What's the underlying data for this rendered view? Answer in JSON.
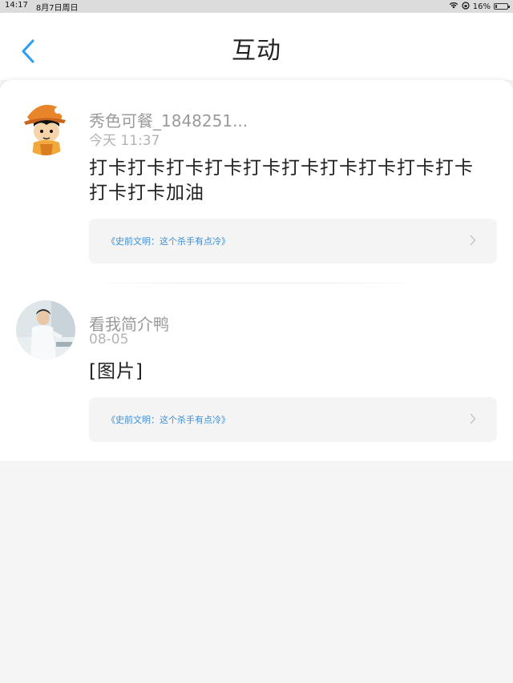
{
  "status_bar": {
    "time": "14:17",
    "date": "8月7日周日",
    "battery": "16%",
    "battery_level": 0.16
  },
  "header": {
    "title": "互动"
  },
  "items": [
    {
      "name": "秀色可餐_1848251...",
      "time": "今天 11:37",
      "content": "打卡打卡打卡打卡打卡打卡打卡打卡打卡打卡打卡打卡加油",
      "reference": "《史前文明：这个杀手有点冷》"
    },
    {
      "name": "看我简介鸭",
      "time": "08-05",
      "content": "[图片]",
      "reference": "《史前文明：这个杀手有点冷》"
    }
  ],
  "colors": {
    "accent": "#3a8fd6",
    "back_arrow": "#2a9df4"
  }
}
